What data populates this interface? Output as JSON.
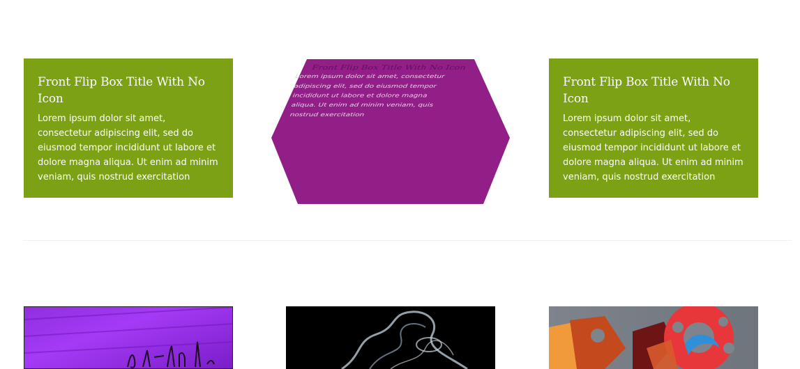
{
  "cards": [
    {
      "title": "Front Flip Box Title With No Icon",
      "text": "Lorem ipsum dolor sit amet, consectetur adipiscing elit, sed do eiusmod tempor incididunt ut labore et dolore magna aliqua. Ut enim ad minim veniam, quis nostrud exercitation"
    },
    {
      "title": "Front Flip Box Title With No Icon",
      "text_lines": [
        "Lorem ipsum dolor sit amet, consectetur",
        "adipiscing elit, sed do eiusmod tempor",
        "incididunt ut labore et dolore magna",
        "aliqua. Ut enim ad minim veniam, quis",
        "nostrud exercitation"
      ]
    },
    {
      "title": "Front Flip Box Title With No Icon",
      "text": "Lorem ipsum dolor sit amet, consectetur adipiscing elit, sed do eiusmod tempor incididunt ut labore et dolore magna aliqua. Ut enim ad minim veniam, quis nostrud exercitation"
    }
  ],
  "colors": {
    "green": "#7ca114",
    "purple": "#921f88",
    "white": "#ffffff"
  },
  "images": [
    {
      "icon": "purple-graffiti-wall-image"
    },
    {
      "icon": "smoke-image"
    },
    {
      "icon": "abstract-sculpture-image"
    }
  ]
}
